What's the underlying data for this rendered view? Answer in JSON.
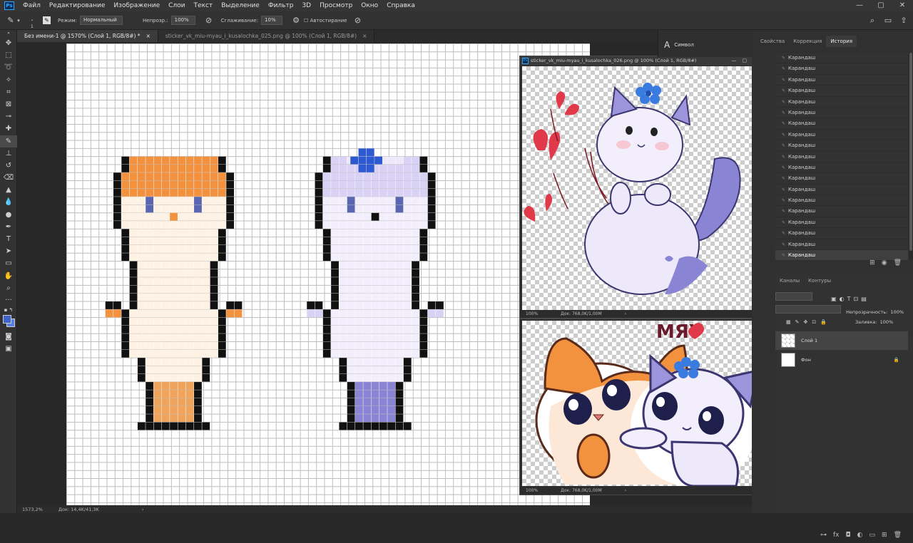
{
  "menu": {
    "logo": "Ps",
    "items": [
      "Файл",
      "Редактирование",
      "Изображение",
      "Слои",
      "Текст",
      "Выделение",
      "Фильтр",
      "3D",
      "Просмотр",
      "Окно",
      "Справка"
    ]
  },
  "options": {
    "brush_size": "1",
    "mode_label": "Режим:",
    "mode_value": "Нормальный",
    "opacity_label": "Непрозр.:",
    "opacity_value": "100%",
    "smoothing_label": "Сглаживание:",
    "smoothing_value": "10%",
    "autoerase_label": "Автостирание"
  },
  "tabs": [
    {
      "label": "Без имени-1 @ 1570% (Слой 1, RGB/8#) *",
      "close": "×"
    },
    {
      "label": "sticker_vk_miu-myau_i_kusalochka_025.png @ 100% (Слой 1, RGB/8#)",
      "close": "×"
    }
  ],
  "status": {
    "zoom": "1573,2%",
    "doc": "Док: 14,4K/41,3K",
    "arrow": "›"
  },
  "float1": {
    "title": "sticker_vk_miu-myau_i_kusalochka_026.png @ 100% (Слой 1, RGB/8#)",
    "zoom": "100%",
    "doc": "Док: 768,0K/1,00M",
    "arrow": "›"
  },
  "float2": {
    "zoom": "100%",
    "doc": "Док: 768,0K/1,00M",
    "arrow": "›",
    "caption": "МЯУ"
  },
  "symbol_panel": {
    "icon": "A",
    "label": "Символ"
  },
  "panel_tabs": [
    "Свойства",
    "Коррекция",
    "История"
  ],
  "history_items": [
    "Карандаш",
    "Карандаш",
    "Карандаш",
    "Карандаш",
    "Карандаш",
    "Карандаш",
    "Карандаш",
    "Карандаш",
    "Карандаш",
    "Карандаш",
    "Карандаш",
    "Карандаш",
    "Карандаш",
    "Карандаш",
    "Карандаш",
    "Карандаш",
    "Карандаш",
    "Карандаш",
    "Карандаш"
  ],
  "layers_tabs": [
    "Каналы",
    "Контуры"
  ],
  "layers": {
    "opacity_label": "Непрозрачность:",
    "opacity_value": "100%",
    "fill_label": "Заливка:",
    "fill_value": "100%",
    "items": [
      {
        "name": "Слой 1"
      },
      {
        "name": "Фон",
        "locked": true
      }
    ]
  }
}
